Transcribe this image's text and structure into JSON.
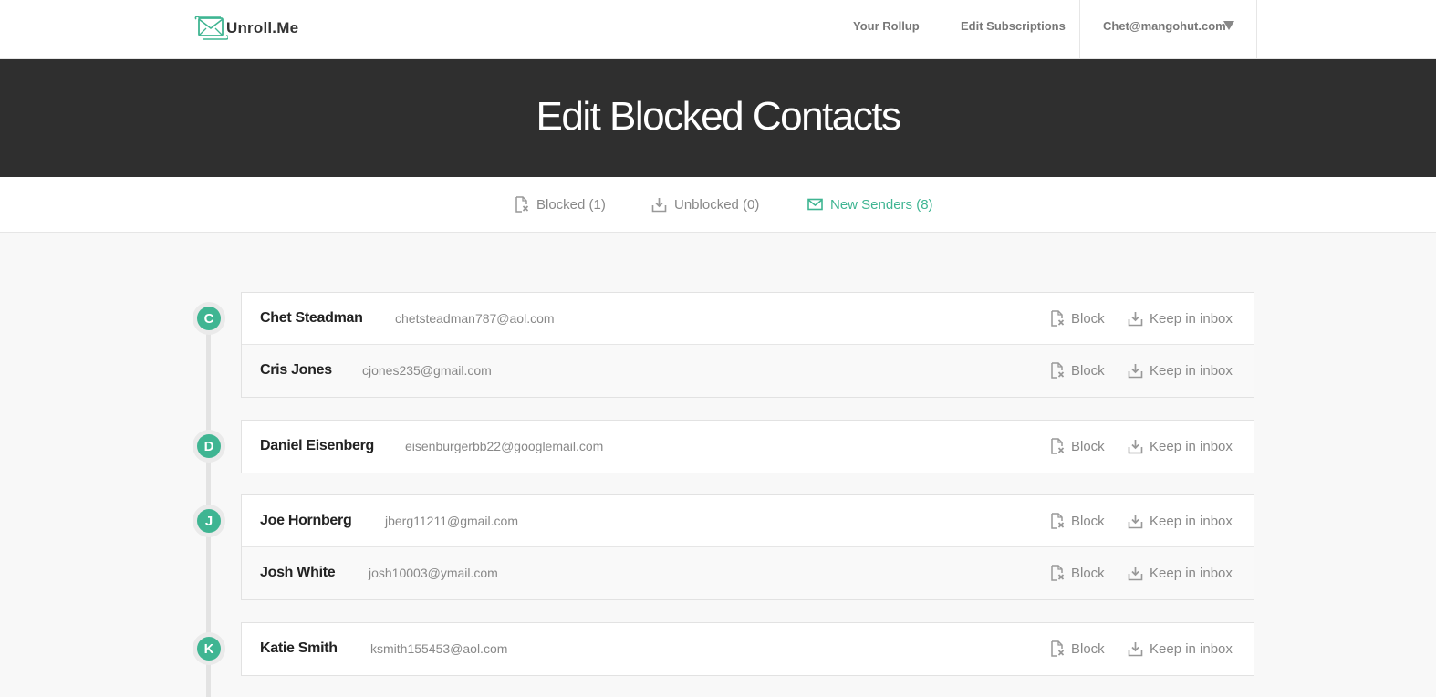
{
  "brand": {
    "name": "Unroll.Me",
    "accent": "#3fb592"
  },
  "nav": {
    "rollup": "Your Rollup",
    "edit_subscriptions": "Edit Subscriptions",
    "user_email": "Chet@mangohut.com"
  },
  "hero": {
    "title": "Edit Blocked Contacts"
  },
  "tabs": {
    "blocked": "Blocked (1)",
    "unblocked": "Unblocked (0)",
    "new_senders": "New Senders (8)"
  },
  "actions": {
    "block": "Block",
    "keep": "Keep in inbox"
  },
  "groups": [
    {
      "letter": "C",
      "contacts": [
        {
          "name": "Chet Steadman",
          "email": "chetsteadman787@aol.com"
        },
        {
          "name": "Cris Jones",
          "email": "cjones235@gmail.com"
        }
      ]
    },
    {
      "letter": "D",
      "contacts": [
        {
          "name": "Daniel Eisenberg",
          "email": "eisenburgerbb22@googlemail.com"
        }
      ]
    },
    {
      "letter": "J",
      "contacts": [
        {
          "name": "Joe Hornberg",
          "email": "jberg11211@gmail.com"
        },
        {
          "name": "Josh White",
          "email": "josh10003@ymail.com"
        }
      ]
    },
    {
      "letter": "K",
      "contacts": [
        {
          "name": "Katie Smith",
          "email": "ksmith155453@aol.com"
        }
      ]
    }
  ]
}
